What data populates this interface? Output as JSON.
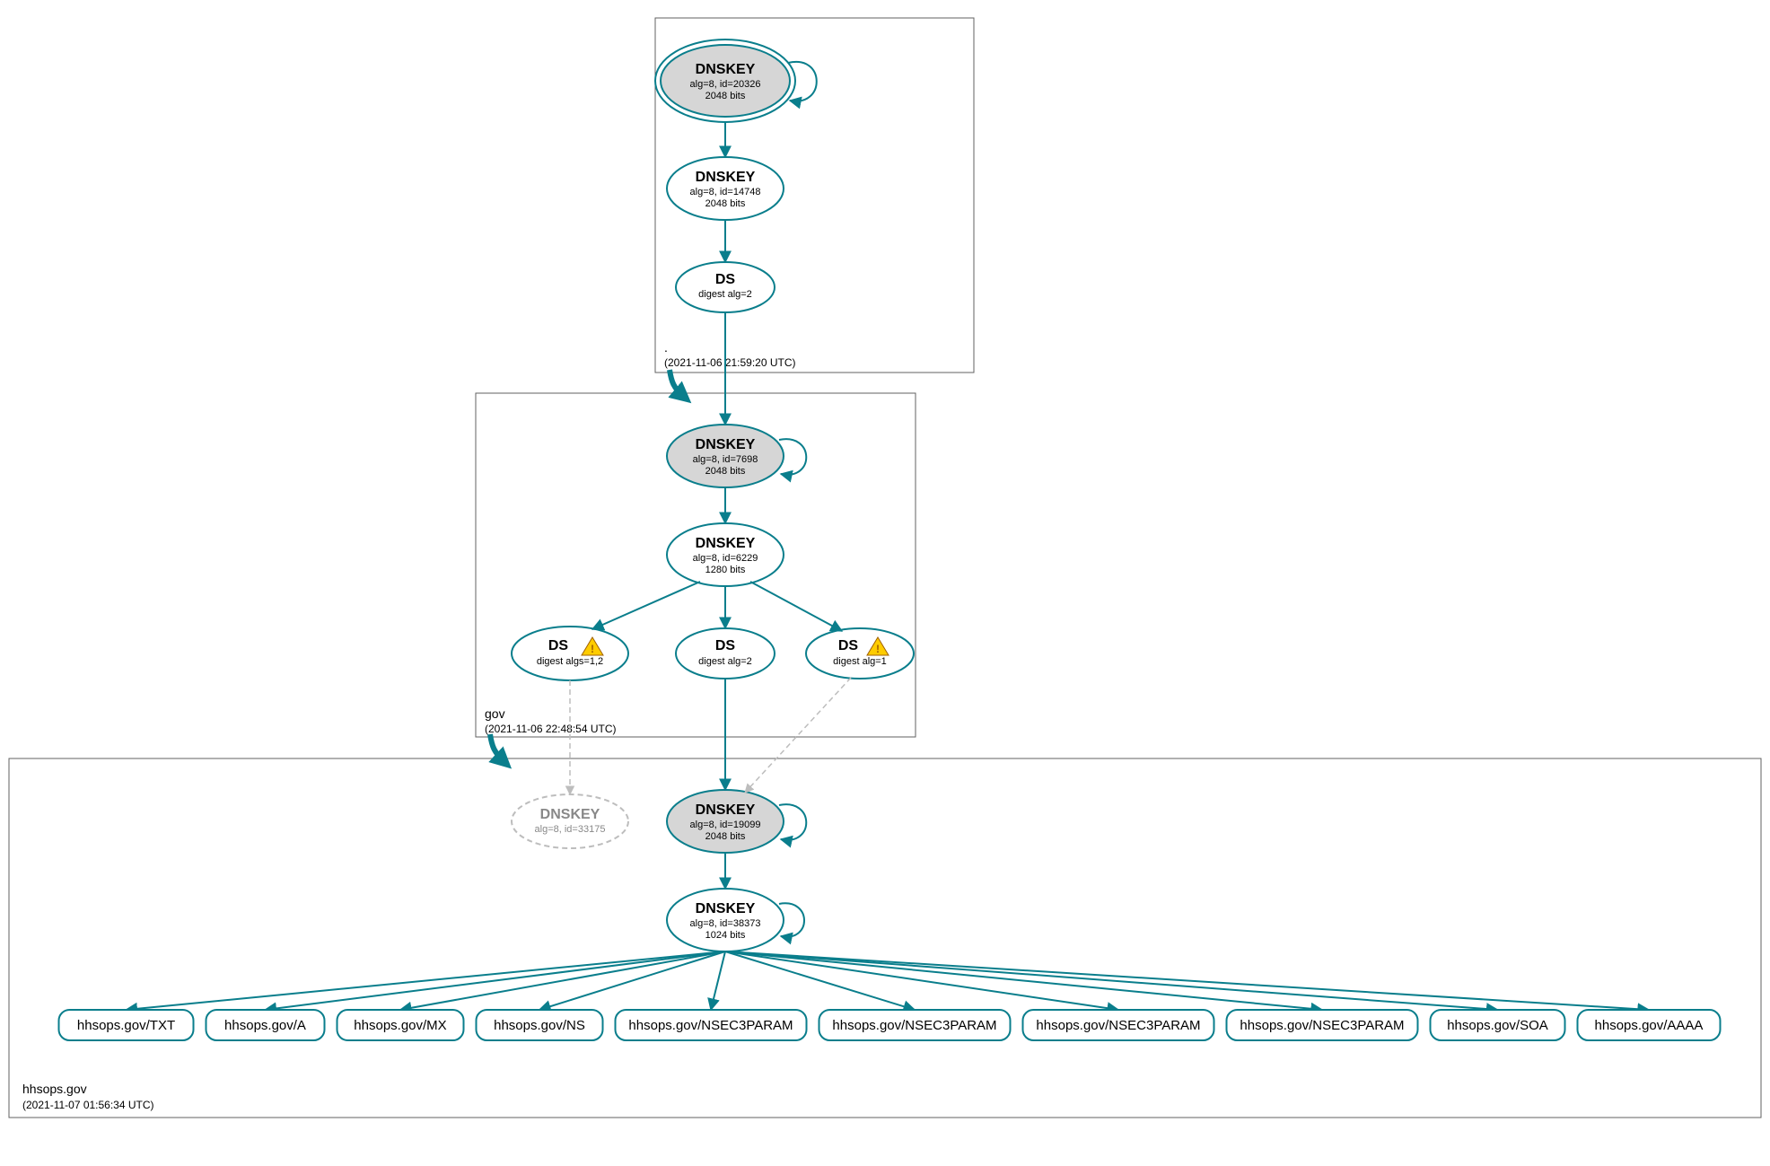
{
  "colors": {
    "edge": "#0a7e8c",
    "node_fill_ksk": "#d6d6d6",
    "node_fill": "#ffffff",
    "dashed": "#bdbdbd",
    "box": "#616161"
  },
  "zones": {
    "root": {
      "label": ".",
      "timestamp": "(2021-11-06 21:59:20 UTC)"
    },
    "gov": {
      "label": "gov",
      "timestamp": "(2021-11-06 22:48:54 UTC)"
    },
    "hhsops": {
      "label": "hhsops.gov",
      "timestamp": "(2021-11-07 01:56:34 UTC)"
    }
  },
  "nodes": {
    "root_ksk": {
      "title": "DNSKEY",
      "line1": "alg=8, id=20326",
      "line2": "2048 bits"
    },
    "root_zsk": {
      "title": "DNSKEY",
      "line1": "alg=8, id=14748",
      "line2": "2048 bits"
    },
    "root_ds": {
      "title": "DS",
      "line1": "digest alg=2"
    },
    "gov_ksk": {
      "title": "DNSKEY",
      "line1": "alg=8, id=7698",
      "line2": "2048 bits"
    },
    "gov_zsk": {
      "title": "DNSKEY",
      "line1": "alg=8, id=6229",
      "line2": "1280 bits"
    },
    "gov_ds1": {
      "title": "DS",
      "line1": "digest algs=1,2"
    },
    "gov_ds2": {
      "title": "DS",
      "line1": "digest alg=2"
    },
    "gov_ds3": {
      "title": "DS",
      "line1": "digest alg=1"
    },
    "hhsops_dnskey_dashed": {
      "title": "DNSKEY",
      "line1": "alg=8, id=33175"
    },
    "hhsops_ksk": {
      "title": "DNSKEY",
      "line1": "alg=8, id=19099",
      "line2": "2048 bits"
    },
    "hhsops_zsk": {
      "title": "DNSKEY",
      "line1": "alg=8, id=38373",
      "line2": "1024 bits"
    }
  },
  "rrsets": [
    "hhsops.gov/TXT",
    "hhsops.gov/A",
    "hhsops.gov/MX",
    "hhsops.gov/NS",
    "hhsops.gov/NSEC3PARAM",
    "hhsops.gov/NSEC3PARAM",
    "hhsops.gov/NSEC3PARAM",
    "hhsops.gov/NSEC3PARAM",
    "hhsops.gov/SOA",
    "hhsops.gov/AAAA"
  ]
}
